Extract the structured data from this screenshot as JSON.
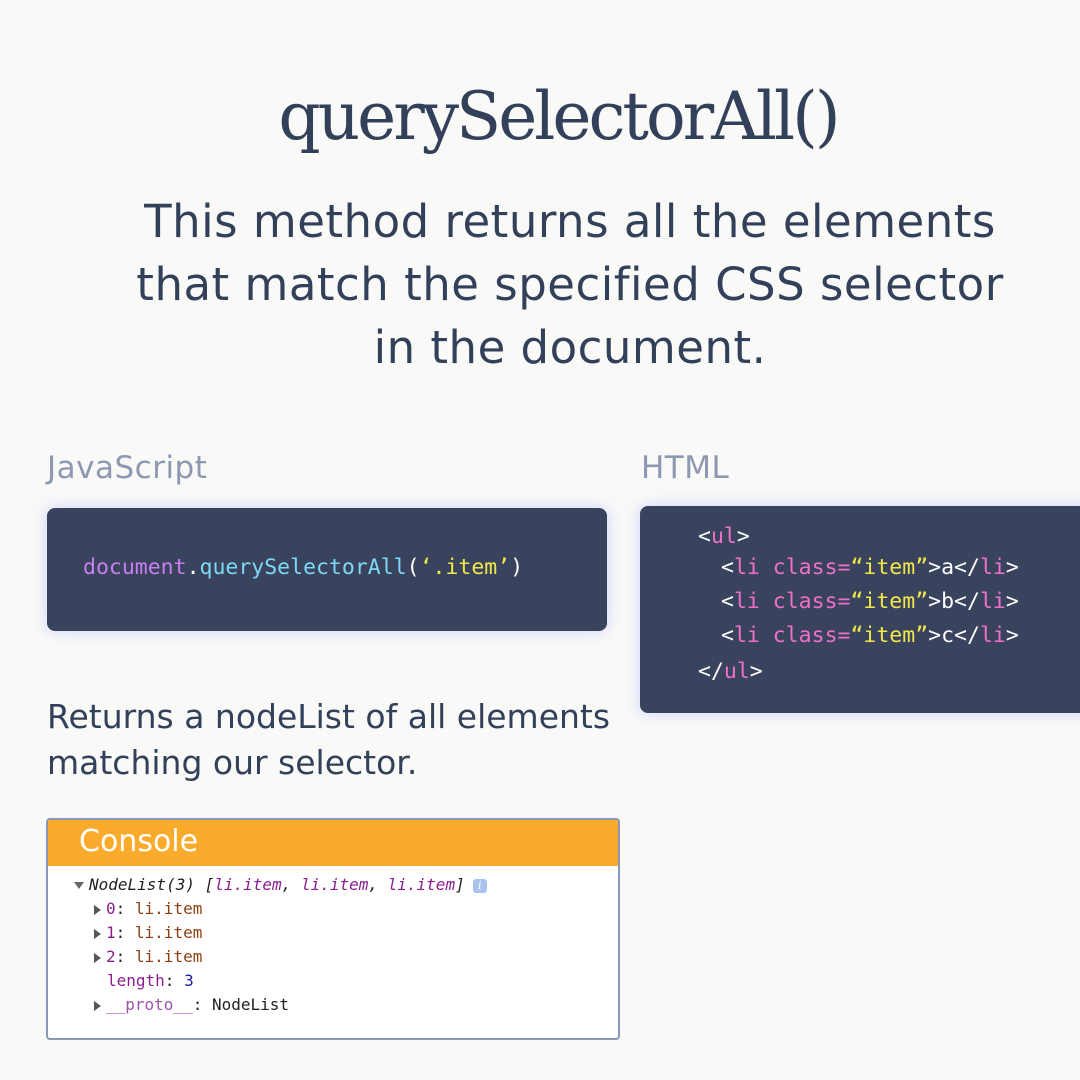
{
  "title": "querySelectorAll()",
  "subtitle": "This method returns all the elements that match the specified CSS selector in the document.",
  "sections": {
    "js_label": "JavaScript",
    "html_label": "HTML"
  },
  "js_code": {
    "object": "document",
    "dot": ".",
    "method": "querySelectorAll",
    "open_paren": "(",
    "argument": "‘.item’",
    "close_paren": ")"
  },
  "html_code": {
    "ul_open": {
      "lt": "<",
      "tag": "ul",
      "gt": ">"
    },
    "items": [
      {
        "lt": "<",
        "tag": "li",
        "attr": "class=",
        "value": "“item”",
        "gt": ">",
        "text": "a",
        "close_lt": "</",
        "close_tag": "li",
        "close_gt": ">"
      },
      {
        "lt": "<",
        "tag": "li",
        "attr": "class=",
        "value": "“item”",
        "gt": ">",
        "text": "b",
        "close_lt": "</",
        "close_tag": "li",
        "close_gt": ">"
      },
      {
        "lt": "<",
        "tag": "li",
        "attr": "class=",
        "value": "“item”",
        "gt": ">",
        "text": "c",
        "close_lt": "</",
        "close_tag": "li",
        "close_gt": ">"
      }
    ],
    "ul_close": {
      "lt": "</",
      "tag": "ul",
      "gt": ">"
    }
  },
  "returns_text": "Returns a nodeList of all elements matching our selector.",
  "console": {
    "header": "Console",
    "summary": {
      "name": "NodeList(3)",
      "open": " [",
      "items": [
        "li.item",
        "li.item",
        "li.item"
      ],
      "sep": ", ",
      "close": "]",
      "info": "i"
    },
    "entries": [
      {
        "key": "0",
        "colon": ": ",
        "value": "li.item"
      },
      {
        "key": "1",
        "colon": ": ",
        "value": "li.item"
      },
      {
        "key": "2",
        "colon": ": ",
        "value": "li.item"
      }
    ],
    "length": {
      "key": "length",
      "colon": ": ",
      "value": "3"
    },
    "proto": {
      "key": "__proto__",
      "colon": ": ",
      "value": "NodeList"
    }
  }
}
